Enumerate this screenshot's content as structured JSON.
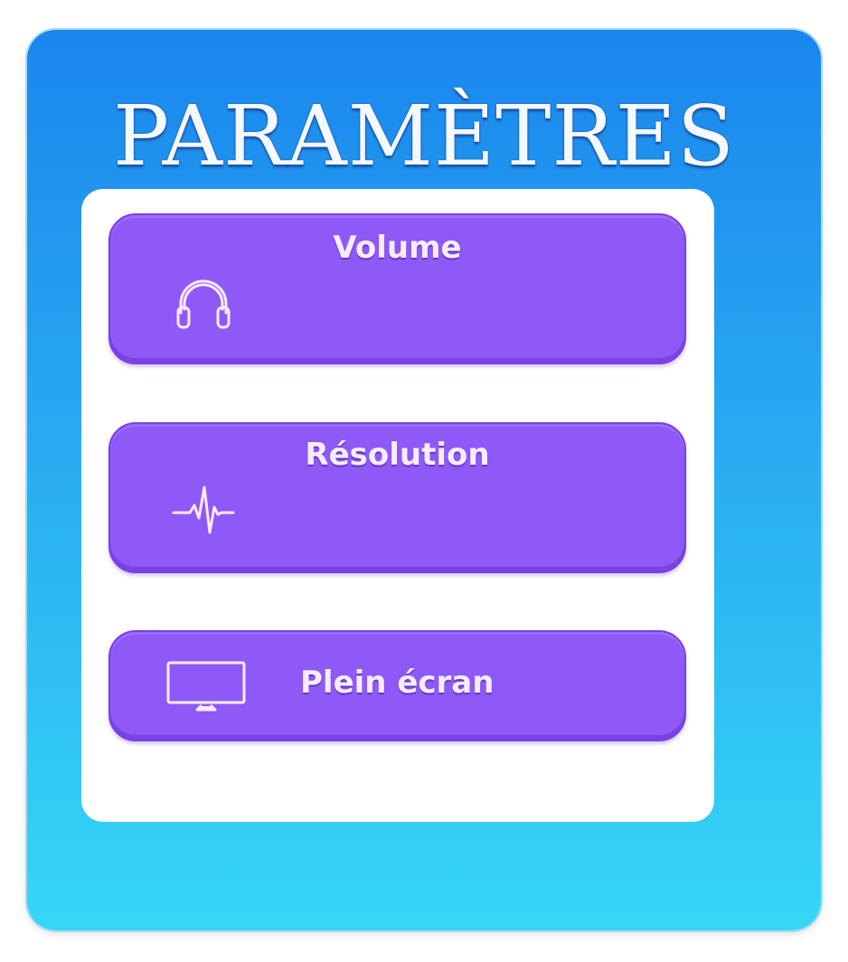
{
  "header": {
    "title": "PARAMÈTRES"
  },
  "settings": {
    "items": [
      {
        "label": "Volume",
        "icon": "headphones-icon"
      },
      {
        "label": "Résolution",
        "icon": "pulse-icon"
      },
      {
        "label": "Plein écran",
        "icon": "monitor-icon"
      }
    ]
  },
  "colors": {
    "panel_top": "#1a86ee",
    "panel_bottom": "#36d7f6",
    "button": "#8f59f7",
    "text": "#f5edff"
  }
}
